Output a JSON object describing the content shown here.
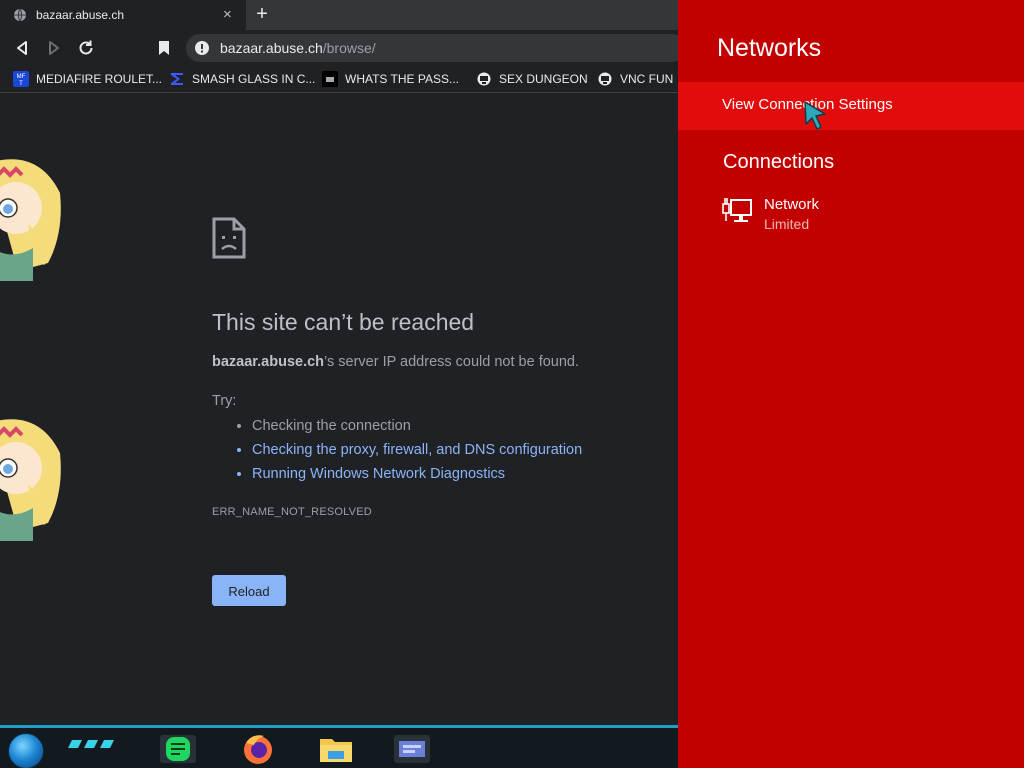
{
  "tab": {
    "title": "bazaar.abuse.ch",
    "close": "×",
    "new_tab": "+"
  },
  "address": {
    "host": "bazaar.abuse.ch",
    "path": "/browse/"
  },
  "bookmarks": [
    {
      "label": "MEDIAFIRE ROULET...",
      "icon": "mediafire-icon"
    },
    {
      "label": "SMASH GLASS IN C...",
      "icon": "sigma-icon"
    },
    {
      "label": "WHATS THE PASS...",
      "icon": "site-icon"
    },
    {
      "label": "SEX DUNGEON",
      "icon": "vnc-icon"
    },
    {
      "label": "VNC FUN",
      "icon": "vnc-icon"
    }
  ],
  "error": {
    "title": "This site can’t be reached",
    "host": "bazaar.abuse.ch",
    "description": "’s server IP address could not be found.",
    "try_label": "Try:",
    "suggestions": [
      "Checking the connection",
      "Checking the proxy, firewall, and DNS configuration",
      "Running Windows Network Diagnostics"
    ],
    "code": "ERR_NAME_NOT_RESOLVED",
    "reload": "Reload"
  },
  "networks_panel": {
    "title": "Networks",
    "view_settings": "View Connection Settings",
    "connections_heading": "Connections",
    "connection": {
      "name": "Network",
      "status": "Limited"
    }
  },
  "colors": {
    "panel": "#c20000",
    "panel_highlight": "#e20c0c",
    "link": "#8ab4f8",
    "taskbar_accent": "#1fa0c9"
  }
}
